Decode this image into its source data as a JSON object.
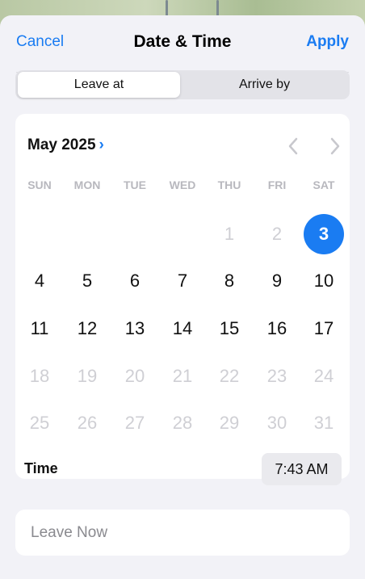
{
  "nav": {
    "cancel_label": "Cancel",
    "title": "Date & Time",
    "apply_label": "Apply"
  },
  "segmented": {
    "left_label": "Leave at",
    "right_label": "Arrive by",
    "selected": "Leave at"
  },
  "calendar": {
    "month_label": "May 2025",
    "weekdays": [
      "SUN",
      "MON",
      "TUE",
      "WED",
      "THU",
      "FRI",
      "SAT"
    ],
    "weeks": [
      [
        "",
        "",
        "",
        "",
        "1",
        "2",
        "3"
      ],
      [
        "4",
        "5",
        "6",
        "7",
        "8",
        "9",
        "10"
      ],
      [
        "11",
        "12",
        "13",
        "14",
        "15",
        "16",
        "17"
      ],
      [
        "18",
        "19",
        "20",
        "21",
        "22",
        "23",
        "24"
      ],
      [
        "25",
        "26",
        "27",
        "28",
        "29",
        "30",
        "31"
      ]
    ],
    "selected_day": "3",
    "disabled_days": [
      "1",
      "2",
      "18",
      "19",
      "20",
      "21",
      "22",
      "23",
      "24",
      "25",
      "26",
      "27",
      "28",
      "29",
      "30",
      "31"
    ]
  },
  "time": {
    "label": "Time",
    "value": "7:43 AM"
  },
  "leave_now": {
    "label": "Leave Now"
  },
  "colors": {
    "accent": "#1a7cf2",
    "disabled_text": "#cfcfd4",
    "sheet_background": "#f2f2f7"
  }
}
